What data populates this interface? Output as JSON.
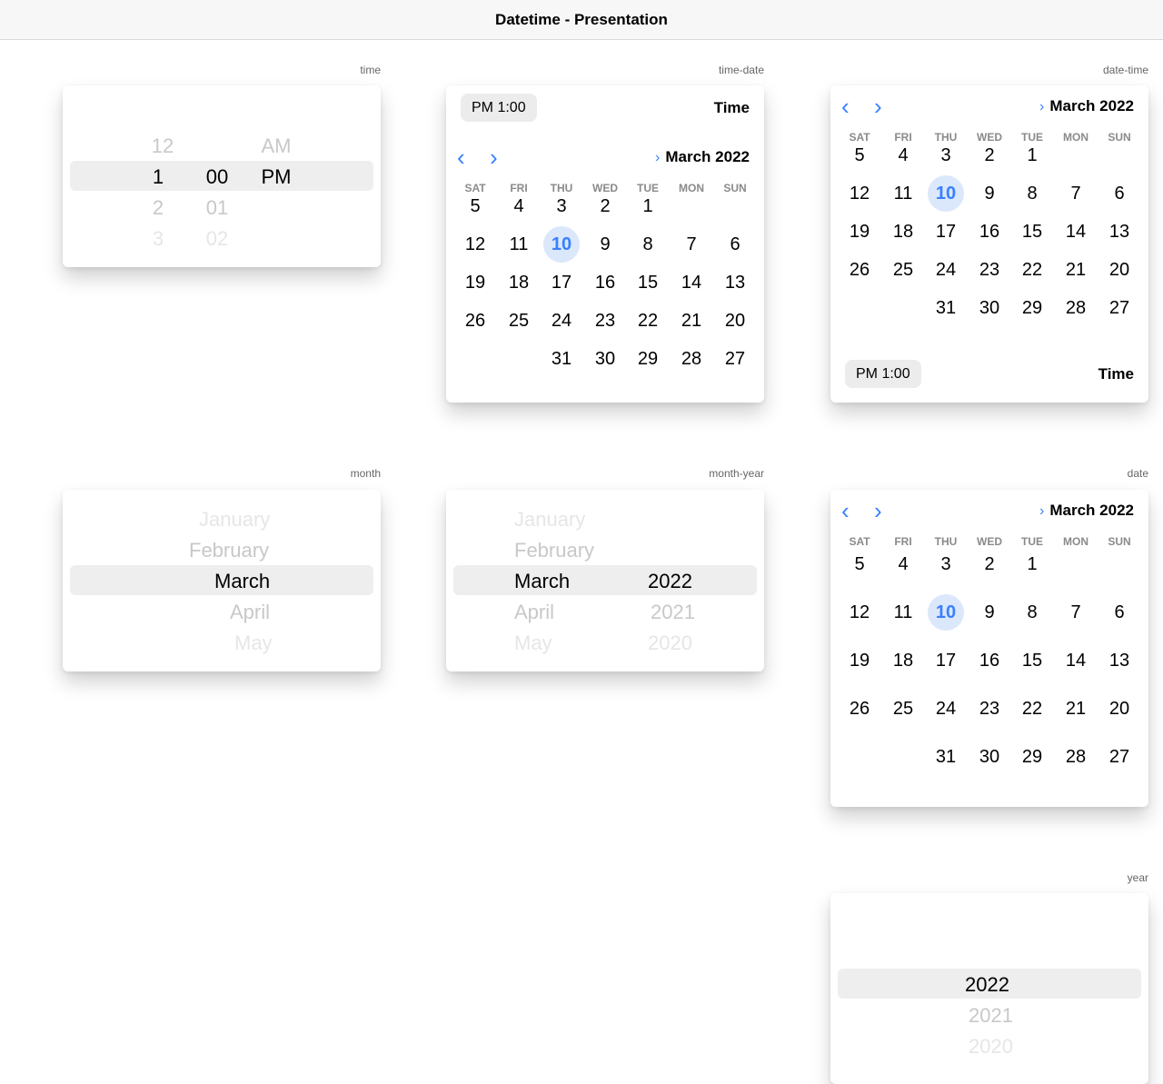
{
  "toolbar": {
    "title": "Datetime - Presentation"
  },
  "labels": {
    "time": "time",
    "time_date": "time-date",
    "date_time": "date-time",
    "month": "month",
    "month_year": "month-year",
    "date": "date",
    "year": "year"
  },
  "time_picker": {
    "hours": [
      "12",
      "1",
      "2",
      "3"
    ],
    "minutes": [
      "00",
      "01",
      "02"
    ],
    "ampm": [
      "AM",
      "PM"
    ]
  },
  "calendar": {
    "month_year": "March 2022",
    "weekdays": [
      "SAT",
      "FRI",
      "THU",
      "WED",
      "TUE",
      "MON",
      "SUN"
    ],
    "weeks": [
      [
        "5",
        "4",
        "3",
        "2",
        "1",
        "",
        ""
      ],
      [
        "12",
        "11",
        "10",
        "9",
        "8",
        "7",
        "6"
      ],
      [
        "19",
        "18",
        "17",
        "16",
        "15",
        "14",
        "13"
      ],
      [
        "26",
        "25",
        "24",
        "23",
        "22",
        "21",
        "20"
      ],
      [
        "",
        "",
        "31",
        "30",
        "29",
        "28",
        "27"
      ]
    ],
    "today": "10",
    "time_value": "PM 1:00",
    "time_label": "Time",
    "prev_icon": "chevron-left-icon",
    "next_icon": "chevron-right-icon",
    "accent": "#3880ff"
  },
  "month_picker": {
    "months": [
      "January",
      "February",
      "March",
      "April",
      "May"
    ]
  },
  "month_year_picker": {
    "months": [
      "January",
      "February",
      "March",
      "April",
      "May"
    ],
    "years": [
      "2022",
      "2021",
      "2020"
    ]
  },
  "year_picker": {
    "years": [
      "2022",
      "2021",
      "2020"
    ]
  }
}
